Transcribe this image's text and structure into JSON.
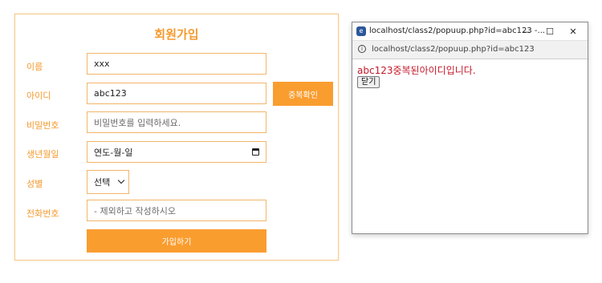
{
  "signup_form": {
    "title": "회원가입",
    "labels": {
      "name": "이름",
      "user_id": "아이디",
      "password": "비밀번호",
      "birthdate": "생년월일",
      "gender": "성별",
      "phone": "전화번호"
    },
    "values": {
      "name": "xxx",
      "user_id": "abc123",
      "birthdate": "연도-월-일",
      "gender": "선택"
    },
    "placeholders": {
      "password": "비밀번호를 입력하세요.",
      "phone": "- 제외하고 작성하시오"
    },
    "buttons": {
      "check_duplicate": "중복확인",
      "submit": "가입하기"
    },
    "accent_color": "#fa9d2f"
  },
  "popup": {
    "window_title": "localhost/class2/popuup.php?id=abc123 -...",
    "address": "localhost/class2/popuup.php?id=abc123",
    "message": "abc123중복된아이디입니다.",
    "close_button": "닫기",
    "window_controls": [
      "minimize-icon",
      "maximize-icon",
      "close-icon"
    ],
    "message_color": "#c3182a"
  }
}
